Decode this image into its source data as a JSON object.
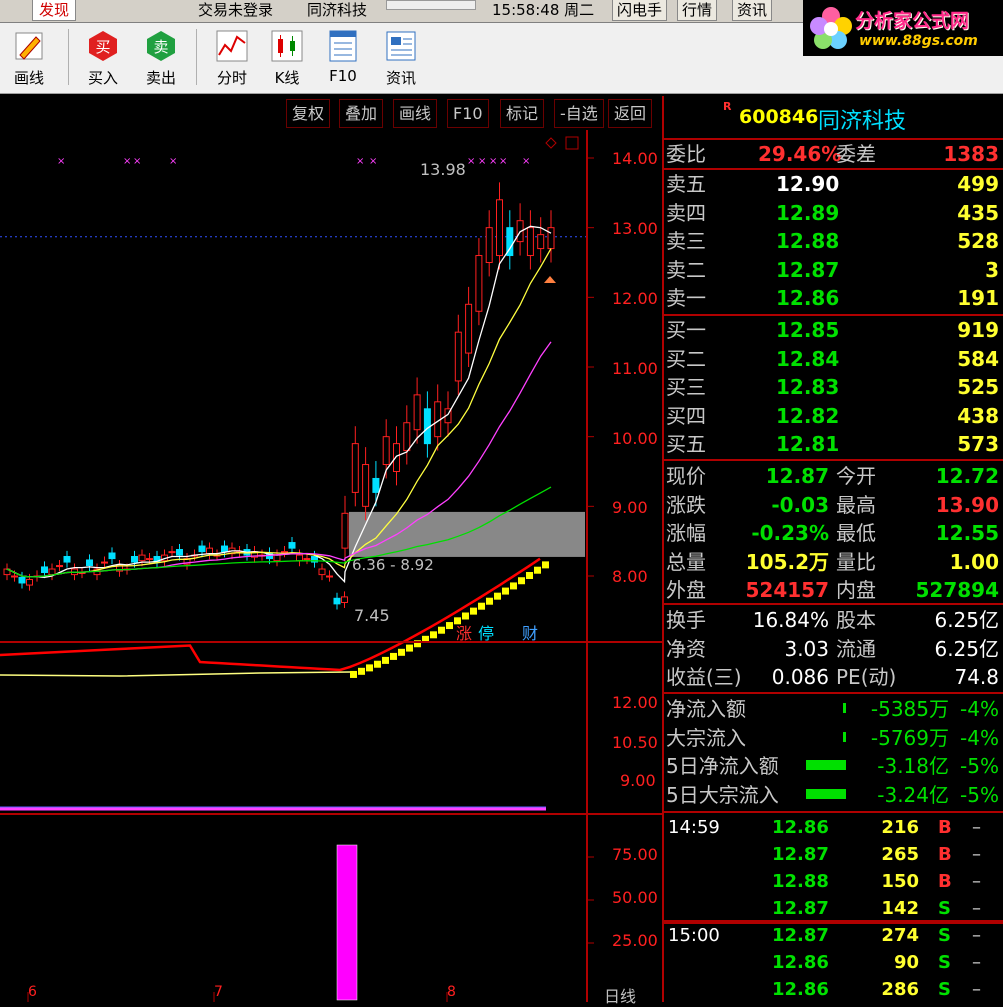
{
  "topbar": {
    "find_tab": "发现",
    "login_status": "交易未登录",
    "stock_name": "同济科技",
    "clock": "15:58:48 周二",
    "buttons": [
      "闪电手",
      "行情",
      "资讯"
    ],
    "logo_brand": "分析家公式网",
    "logo_site": "www.88gs.com"
  },
  "toolbar": {
    "draw": "画线",
    "buy": "买入",
    "sell": "卖出",
    "intraday": "分时",
    "kline": "K线",
    "f10": "F10",
    "news": "资讯",
    "buy_glyph": "买",
    "sell_glyph": "卖"
  },
  "chart_menu": {
    "items": [
      "复权",
      "叠加",
      "画线",
      "F10",
      "标记",
      "-自选",
      "返回"
    ]
  },
  "chart": {
    "y_ticks": [
      "14.00",
      "13.00",
      "12.00",
      "11.00",
      "10.00",
      "9.00",
      "8.00"
    ],
    "annotation_high": "13.98",
    "annotation_low": "7.45",
    "range_label": "6.36 - 8.92",
    "badges": [
      "涨",
      "停",
      "财"
    ],
    "x_labels": [
      "6",
      "7",
      "8"
    ],
    "period": "日线",
    "ind1_ticks": [
      "12.00",
      "10.50",
      "9.00"
    ],
    "ind2_ticks": [
      "75.00",
      "50.00",
      "25.00"
    ]
  },
  "colors": {
    "up": "#ff2020",
    "down": "#00e0ff",
    "ma5": "#ffffff",
    "ma10": "#ffff40",
    "ma20": "#ff40ff",
    "ma60": "#00e000",
    "frame": "#b00000"
  },
  "stock": {
    "flag": "R",
    "code": "600846",
    "name": "同济科技"
  },
  "ratio": {
    "label1": "委比",
    "value1": "29.46%",
    "label2": "委差",
    "value2": "1383"
  },
  "asks": [
    {
      "label": "卖五",
      "price": "12.90",
      "vol": "499"
    },
    {
      "label": "卖四",
      "price": "12.89",
      "vol": "435"
    },
    {
      "label": "卖三",
      "price": "12.88",
      "vol": "528"
    },
    {
      "label": "卖二",
      "price": "12.87",
      "vol": "3"
    },
    {
      "label": "卖一",
      "price": "12.86",
      "vol": "191"
    }
  ],
  "bids": [
    {
      "label": "买一",
      "price": "12.85",
      "vol": "919"
    },
    {
      "label": "买二",
      "price": "12.84",
      "vol": "584"
    },
    {
      "label": "买三",
      "price": "12.83",
      "vol": "525"
    },
    {
      "label": "买四",
      "price": "12.82",
      "vol": "438"
    },
    {
      "label": "买五",
      "price": "12.81",
      "vol": "573"
    }
  ],
  "stats": [
    {
      "l1": "现价",
      "v1": "12.87",
      "c1": "green",
      "l2": "今开",
      "v2": "12.72",
      "c2": "green"
    },
    {
      "l1": "涨跌",
      "v1": "-0.03",
      "c1": "green",
      "l2": "最高",
      "v2": "13.90",
      "c2": "red"
    },
    {
      "l1": "涨幅",
      "v1": "-0.23%",
      "c1": "green",
      "l2": "最低",
      "v2": "12.55",
      "c2": "green"
    },
    {
      "l1": "总量",
      "v1": "105.2万",
      "c1": "yellow",
      "l2": "量比",
      "v2": "1.00",
      "c2": "yellow"
    },
    {
      "l1": "外盘",
      "v1": "524157",
      "c1": "red",
      "l2": "内盘",
      "v2": "527894",
      "c2": "green"
    }
  ],
  "fund": [
    {
      "l1": "换手",
      "v1": "16.84%",
      "l2": "股本",
      "v2": "6.25亿"
    },
    {
      "l1": "净资",
      "v1": "3.03",
      "l2": "流通",
      "v2": "6.25亿"
    },
    {
      "l1": "收益(三)",
      "v1": "0.086",
      "l2": "PE(动)",
      "v2": "74.8"
    }
  ],
  "flows": [
    {
      "label": "净流入额",
      "value": "-5385万",
      "pct": "-4%",
      "bar": 0.08
    },
    {
      "label": "大宗流入",
      "value": "-5769万",
      "pct": "-4%",
      "bar": 0.08
    },
    {
      "label": "5日净流入额",
      "value": "-3.18亿",
      "pct": "-5%",
      "bar": 1.0
    },
    {
      "label": "5日大宗流入",
      "value": "-3.24亿",
      "pct": "-5%",
      "bar": 1.0
    }
  ],
  "ticks": [
    {
      "time": "14:59",
      "price": "12.86",
      "vol": "216",
      "side": "B",
      "mark": "–"
    },
    {
      "time": "",
      "price": "12.87",
      "vol": "265",
      "side": "B",
      "mark": "–"
    },
    {
      "time": "",
      "price": "12.88",
      "vol": "150",
      "side": "B",
      "mark": "–"
    },
    {
      "time": "",
      "price": "12.87",
      "vol": "142",
      "side": "S",
      "mark": "–"
    },
    {
      "time": "15:00",
      "price": "12.87",
      "vol": "274",
      "side": "S",
      "mark": "–"
    },
    {
      "time": "",
      "price": "12.86",
      "vol": "90",
      "side": "S",
      "mark": "–"
    },
    {
      "time": "",
      "price": "12.86",
      "vol": "286",
      "side": "S",
      "mark": "–"
    }
  ]
}
